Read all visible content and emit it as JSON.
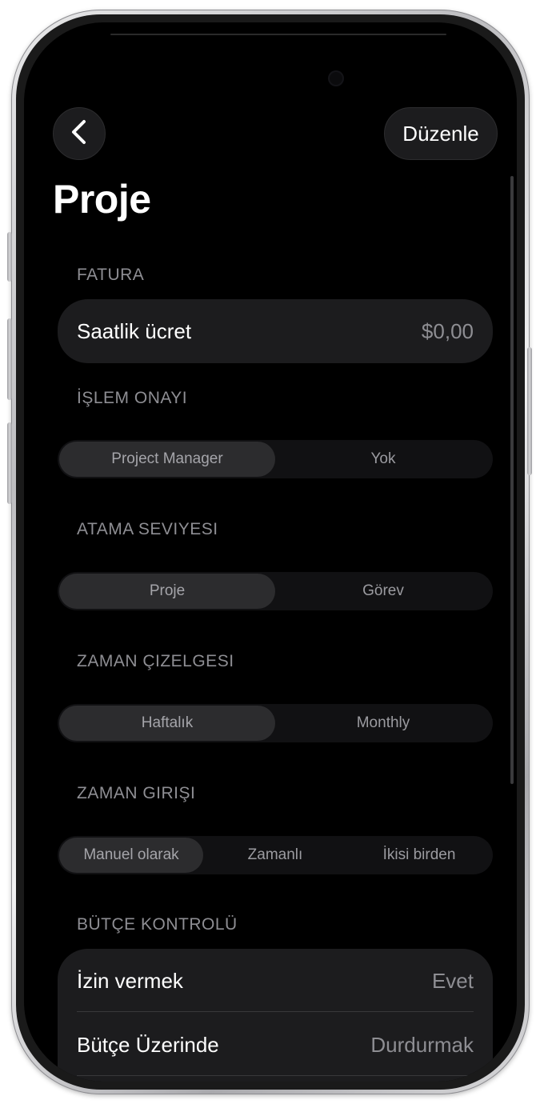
{
  "nav": {
    "back_icon": "chevron-left-icon",
    "edit_label": "Düzenle"
  },
  "title": "Proje",
  "sections": {
    "billing": {
      "header": "FATURA",
      "rows": [
        {
          "label": "Saatlik ücret",
          "value": "$0,00"
        }
      ]
    },
    "approval": {
      "header": "İŞLEM ONAYI",
      "options": [
        "Project Manager",
        "Yok"
      ],
      "selected": "Project Manager"
    },
    "assignment": {
      "header": "ATAMA SEVIYESI",
      "options": [
        "Proje",
        "Görev"
      ],
      "selected": "Proje"
    },
    "timesheet": {
      "header": "ZAMAN ÇIZELGESI",
      "options": [
        "Haftalık",
        "Monthly"
      ],
      "selected": "Haftalık"
    },
    "time_entry": {
      "header": "ZAMAN GIRIŞI",
      "options": [
        "Manuel olarak",
        "Zamanlı",
        "İkisi birden"
      ],
      "selected": "Manuel olarak"
    },
    "budget": {
      "header": "BÜTÇE KONTROLÜ",
      "rows": [
        {
          "label": "İzin vermek",
          "value": "Evet"
        },
        {
          "label": "Bütçe Üzerinde",
          "value": "Durdurmak"
        }
      ]
    }
  },
  "colors": {
    "background": "#000000",
    "card": "#1c1c1e",
    "secondary_text": "#8e8e93",
    "primary_text": "#ffffff"
  }
}
